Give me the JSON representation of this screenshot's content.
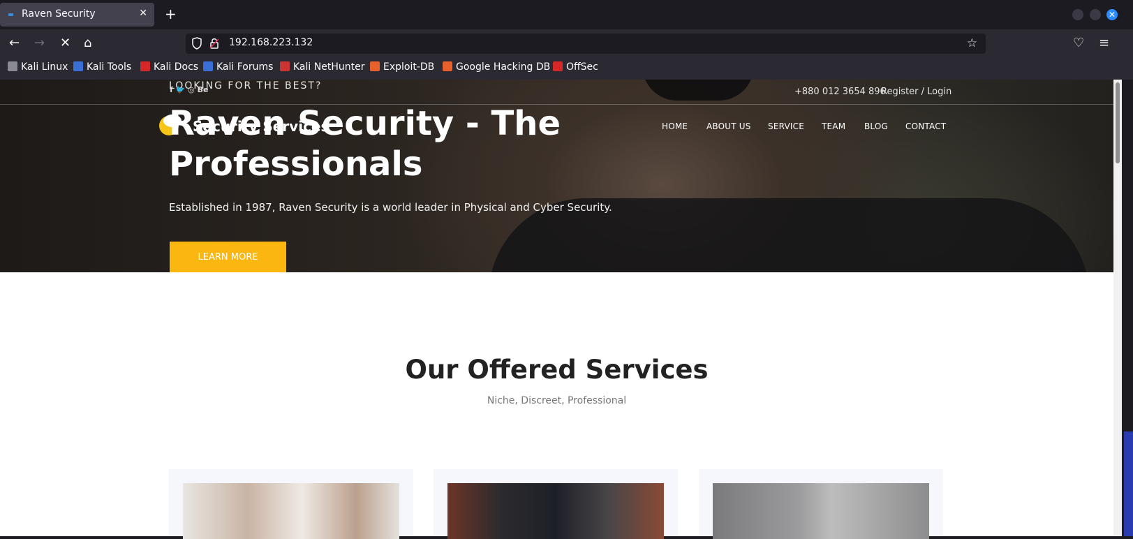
{
  "browser": {
    "tab_title": "Raven Security",
    "tab_close": "✕",
    "new_tab": "+",
    "url": "192.168.223.132",
    "bookmarks": [
      "Kali Linux",
      "Kali Tools",
      "Kali Docs",
      "Kali Forums",
      "Kali NetHunter",
      "Exploit-DB",
      "Google Hacking DB",
      "OffSec"
    ]
  },
  "topbar": {
    "tagline": "LOOKING FOR THE BEST?",
    "social": "f  🐦  ◎  Be",
    "phone": "+880 012 3654 896",
    "register": "Register / Login"
  },
  "logo_text": "Security Services",
  "menu": [
    "HOME",
    "ABOUT US",
    "SERVICE",
    "TEAM",
    "BLOG",
    "CONTACT"
  ],
  "hero": {
    "title": "Raven Security - The Professionals",
    "subtitle": "Established in 1987, Raven Security is a world leader in Physical and Cyber Security.",
    "button": "LEARN MORE"
  },
  "services": {
    "title": "Our Offered Services",
    "subtitle": "Niche, Discreet, Professional"
  }
}
